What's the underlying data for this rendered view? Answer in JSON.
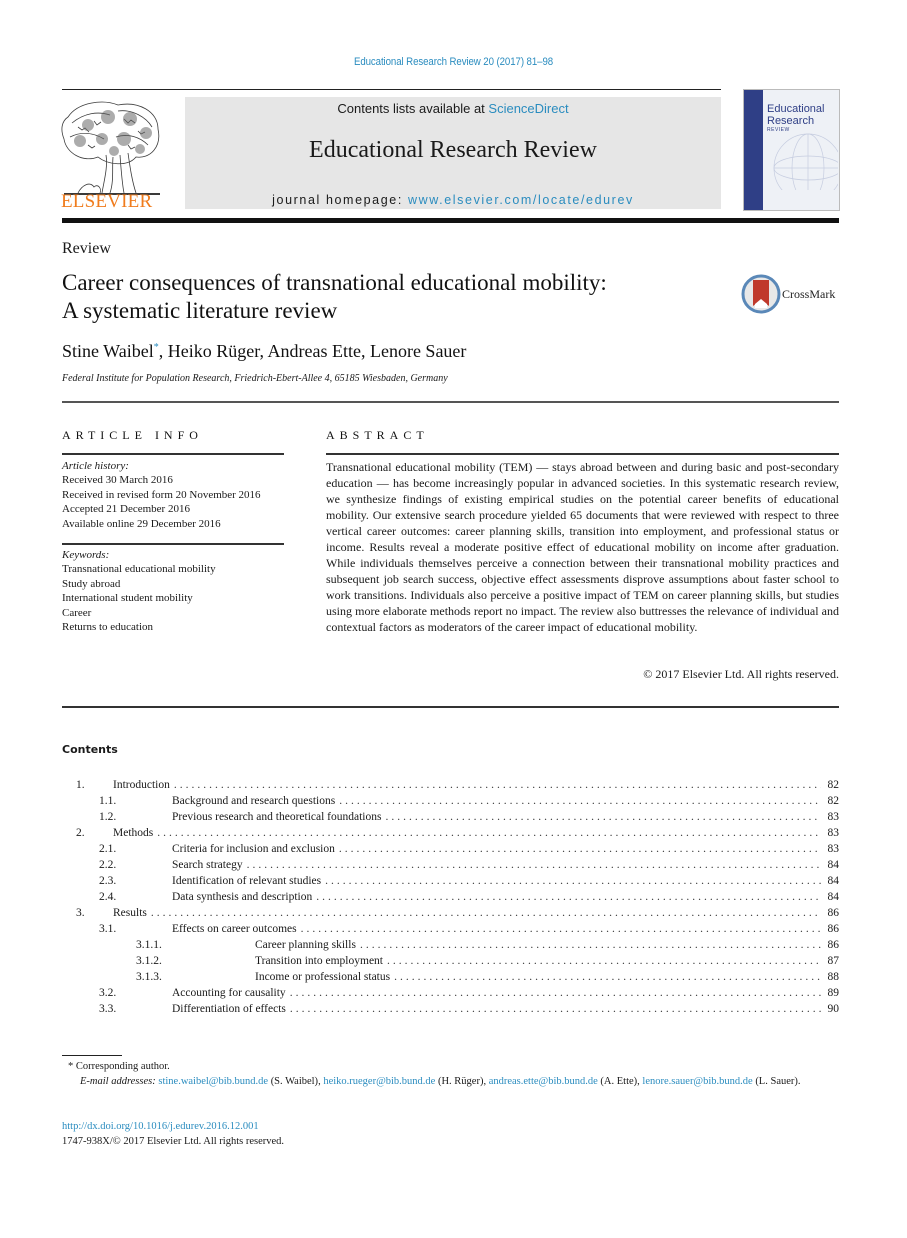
{
  "header": {
    "citation": "Educational Research Review 20 (2017) 81–98",
    "publisher_wordmark": "ELSEVIER",
    "contents_prefix": "Contents lists available at ",
    "contents_link": "ScienceDirect",
    "journal_name": "Educational Research Review",
    "homepage_prefix": "journal homepage: ",
    "homepage_link": "www.elsevier.com/locate/edurev",
    "cover": {
      "title_line1": "Educational",
      "title_line2": "Research",
      "title_line3": "REVIEW"
    },
    "colors": {
      "link": "#2a8cbf",
      "elsevier_orange": "#f07c1d",
      "banner_gray": "#e6e6e6",
      "cover_blue": "#2f3f86"
    }
  },
  "article": {
    "type_label": "Review",
    "title_line1": "Career consequences of transnational educational mobility:",
    "title_line2": "A systematic literature review",
    "crossmark_label": "CrossMark",
    "authors": [
      {
        "name": "Stine Waibel",
        "mark": "*"
      },
      {
        "name": "Heiko Rüger",
        "mark": ""
      },
      {
        "name": "Andreas Ette",
        "mark": ""
      },
      {
        "name": "Lenore Sauer",
        "mark": ""
      }
    ],
    "affiliation": "Federal Institute for Population Research, Friedrich-Ebert-Allee 4, 65185 Wiesbaden, Germany"
  },
  "article_info": {
    "heading": "ARTICLE INFO",
    "history_label": "Article history:",
    "history": [
      "Received 30 March 2016",
      "Received in revised form 20 November 2016",
      "Accepted 21 December 2016",
      "Available online 29 December 2016"
    ],
    "keywords_label": "Keywords:",
    "keywords": [
      "Transnational educational mobility",
      "Study abroad",
      "International student mobility",
      "Career",
      "Returns to education"
    ]
  },
  "abstract": {
    "heading": "ABSTRACT",
    "text": "Transnational educational mobility (TEM) — stays abroad between and during basic and post-secondary education — has become increasingly popular in advanced societies. In this systematic research review, we synthesize findings of existing empirical studies on the potential career benefits of educational mobility. Our extensive search procedure yielded 65 documents that were reviewed with respect to three vertical career outcomes: career planning skills, transition into employment, and professional status or income. Results reveal a moderate positive effect of educational mobility on income after graduation. While individuals themselves perceive a connection between their transnational mobility practices and subsequent job search success, objective effect assessments disprove assumptions about faster school to work transitions. Individuals also perceive a positive impact of TEM on career planning skills, but studies using more elaborate methods report no impact. The review also buttresses the relevance of individual and contextual factors as moderators of the career impact of educational mobility.",
    "copyright": "© 2017 Elsevier Ltd. All rights reserved."
  },
  "contents": {
    "heading": "Contents",
    "entries": [
      {
        "num": "1.",
        "label": "Introduction",
        "page": "82",
        "level": 1
      },
      {
        "num": "1.1.",
        "label": "Background and research questions",
        "page": "82",
        "level": 2
      },
      {
        "num": "1.2.",
        "label": "Previous research and theoretical foundations",
        "page": "83",
        "level": 2
      },
      {
        "num": "2.",
        "label": "Methods",
        "page": "83",
        "level": 1
      },
      {
        "num": "2.1.",
        "label": "Criteria for inclusion and exclusion",
        "page": "83",
        "level": 2
      },
      {
        "num": "2.2.",
        "label": "Search strategy",
        "page": "84",
        "level": 2
      },
      {
        "num": "2.3.",
        "label": "Identification of relevant studies",
        "page": "84",
        "level": 2
      },
      {
        "num": "2.4.",
        "label": "Data synthesis and description",
        "page": "84",
        "level": 2
      },
      {
        "num": "3.",
        "label": "Results",
        "page": "86",
        "level": 1
      },
      {
        "num": "3.1.",
        "label": "Effects on career outcomes",
        "page": "86",
        "level": 2
      },
      {
        "num": "3.1.1.",
        "label": "Career planning skills",
        "page": "86",
        "level": 3
      },
      {
        "num": "3.1.2.",
        "label": "Transition into employment",
        "page": "87",
        "level": 3
      },
      {
        "num": "3.1.3.",
        "label": "Income or professional status",
        "page": "88",
        "level": 3
      },
      {
        "num": "3.2.",
        "label": "Accounting for causality",
        "page": "89",
        "level": 2
      },
      {
        "num": "3.3.",
        "label": "Differentiation of effects",
        "page": "90",
        "level": 2
      }
    ]
  },
  "footnotes": {
    "corresponding_mark": "*",
    "corresponding_text": "Corresponding author.",
    "email_label": "E-mail addresses:",
    "emails": [
      {
        "address": "stine.waibel@bib.bund.de",
        "who": "(S. Waibel)"
      },
      {
        "address": "heiko.rueger@bib.bund.de",
        "who": "(H. Rüger)"
      },
      {
        "address": "andreas.ette@bib.bund.de",
        "who": "(A. Ette)"
      },
      {
        "address": "lenore.sauer@bib.bund.de",
        "who": "(L. Sauer)."
      }
    ],
    "doi": "http://dx.doi.org/10.1016/j.edurev.2016.12.001",
    "issn_copyright": "1747-938X/© 2017 Elsevier Ltd. All rights reserved."
  }
}
